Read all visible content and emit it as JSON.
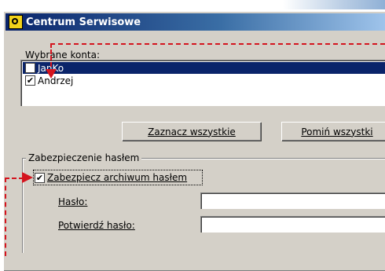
{
  "window": {
    "title": "Centrum Serwisowe"
  },
  "accounts": {
    "label": "Wybrane konta:",
    "items": [
      {
        "name": "JanKo",
        "checked": false,
        "selected": true
      },
      {
        "name": "Andrzej",
        "checked": true,
        "selected": false
      }
    ]
  },
  "buttons": {
    "select_all": "Zaznacz wszystkie",
    "skip_all": "Pomiń wszystki"
  },
  "protection": {
    "group_title": "Zabezpieczenie hasłem",
    "protect_label": "Zabezpiecz archiwum hasłem",
    "protect_checked": true,
    "password_label": "Hasło:",
    "password_value": "",
    "confirm_label": "Potwierdź hasło:",
    "confirm_value": ""
  },
  "colors": {
    "accent_annotation": "#d4141e",
    "titlebar": "#0a246a",
    "selection": "#0a246a"
  },
  "icons": {
    "app": "app-icon",
    "checkmark": "✔"
  }
}
